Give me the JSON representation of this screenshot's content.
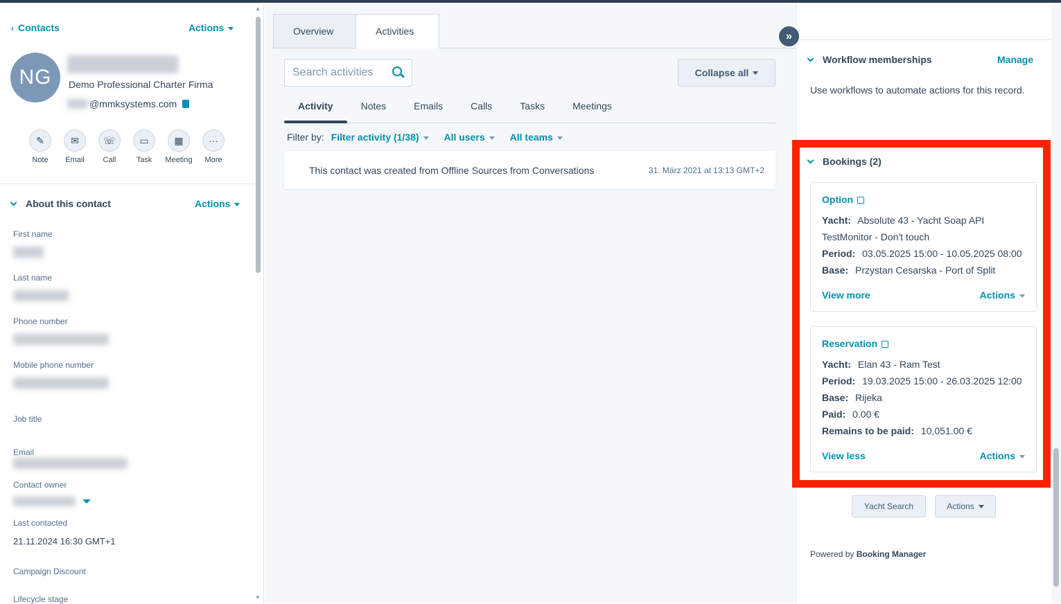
{
  "left": {
    "breadcrumb": "Contacts",
    "actions_label": "Actions",
    "avatar_initials": "NG",
    "company": "Demo Professional Charter Firma",
    "email_domain": "@mmksystems.com",
    "quick_actions": [
      {
        "label": "Note",
        "icon": "note-icon",
        "glyph": "✎"
      },
      {
        "label": "Email",
        "icon": "email-icon",
        "glyph": "✉"
      },
      {
        "label": "Call",
        "icon": "call-icon",
        "glyph": "☏"
      },
      {
        "label": "Task",
        "icon": "task-icon",
        "glyph": "▭"
      },
      {
        "label": "Meeting",
        "icon": "meeting-icon",
        "glyph": "▦"
      },
      {
        "label": "More",
        "icon": "more-icon",
        "glyph": "···"
      }
    ],
    "about_title": "About this contact",
    "about_actions": "Actions",
    "properties": {
      "first_name": "First name",
      "last_name": "Last name",
      "phone": "Phone number",
      "mobile": "Mobile phone number",
      "job_title": "Job title",
      "email": "Email",
      "owner": "Contact owner",
      "last_contacted": "Last contacted",
      "last_contacted_value": "21.11.2024 16:30 GMT+1",
      "campaign": "Campaign Discount",
      "lifecycle": "Lifecycle stage"
    }
  },
  "middle": {
    "tabs": [
      "Overview",
      "Activities"
    ],
    "search_placeholder": "Search activities",
    "collapse_label": "Collapse all",
    "subtabs": [
      "Activity",
      "Notes",
      "Emails",
      "Calls",
      "Tasks",
      "Meetings"
    ],
    "filter_by": "Filter by:",
    "filter_activity": "Filter activity (1/38)",
    "all_users": "All users",
    "all_teams": "All teams",
    "feed": {
      "message": "This contact was created from Offline Sources from Conversations",
      "time": "31. März 2021 at 13:13 GMT+2"
    }
  },
  "right": {
    "workflow_title": "Workflow memberships",
    "workflow_manage": "Manage",
    "workflow_text": "Use workflows to automate actions for this record.",
    "bookings_title": "Bookings (2)",
    "option": {
      "title": "Option",
      "yacht_label": "Yacht:",
      "yacht_line1": "Absolute 43 - Yacht Soap API",
      "yacht_line2": "TestMonitor - Don't touch",
      "period_label": "Period:",
      "period": "03.05.2025 15:00 - 10.05.2025 08:00",
      "base_label": "Base:",
      "base": "Przystan Cesarska - Port of Split",
      "view_more": "View more",
      "actions": "Actions"
    },
    "reservation": {
      "title": "Reservation",
      "yacht_label": "Yacht:",
      "yacht": "Elan 43 - Ram Test",
      "period_label": "Period:",
      "period": "19.03.2025 15:00 - 26.03.2025 12:00",
      "base_label": "Base:",
      "base": "Rijeka",
      "paid_label": "Paid:",
      "paid": "0.00 €",
      "remains_label": "Remains to be paid:",
      "remains": "10,051.00 €",
      "view_less": "View less",
      "actions": "Actions"
    },
    "yacht_search": "Yacht Search",
    "actions_btn": "Actions",
    "powered_prefix": "Powered by",
    "powered_brand": "Booking Manager"
  },
  "colors": {
    "accent": "#0091ae",
    "highlight": "#ff2200",
    "text": "#33475b"
  }
}
